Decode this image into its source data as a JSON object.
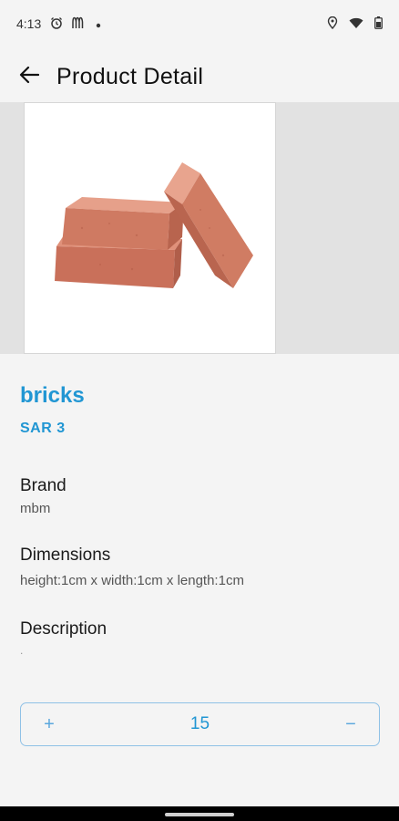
{
  "status_bar": {
    "time": "4:13",
    "left_icons": [
      "alarm-icon",
      "mcdonalds-icon",
      "dot-icon"
    ],
    "right_icons": [
      "location-icon",
      "wifi-icon",
      "battery-icon"
    ]
  },
  "header": {
    "title": "Product Detail",
    "back_icon": "arrow-left-icon"
  },
  "product": {
    "image": "bricks-photo",
    "name": "bricks",
    "price": "SAR 3"
  },
  "details": {
    "brand_label": "Brand",
    "brand_value": "mbm",
    "dimensions_label": "Dimensions",
    "dimensions_value": "height:1cm x width:1cm x length:1cm",
    "description_label": "Description",
    "description_value": "."
  },
  "quantity": {
    "increase_label": "+",
    "value": "15",
    "decrease_label": "−"
  },
  "colors": {
    "accent": "#2196d3",
    "background": "#f4f4f4",
    "image_band": "#e2e2e2"
  }
}
